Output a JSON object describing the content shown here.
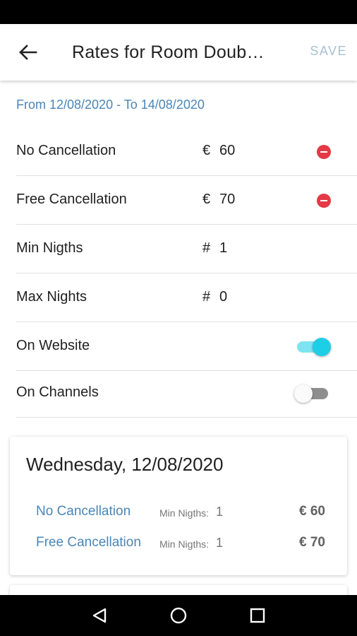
{
  "app_bar": {
    "title": "Rates for Room Doub…",
    "save_label": "SAVE"
  },
  "date_range": "From 12/08/2020 - To 14/08/2020",
  "rates": [
    {
      "label": "No Cancellation",
      "symbol": "€",
      "value": "60",
      "removable": true
    },
    {
      "label": "Free Cancellation",
      "symbol": "€",
      "value": "70",
      "removable": true
    }
  ],
  "nights": [
    {
      "label": "Min Nigths",
      "symbol": "#",
      "value": "1"
    },
    {
      "label": "Max Nights",
      "symbol": "#",
      "value": "0"
    }
  ],
  "toggles": [
    {
      "label": "On Website",
      "on": true
    },
    {
      "label": "On Channels",
      "on": false
    }
  ],
  "day_card": {
    "title": "Wednesday, 12/08/2020",
    "lines": [
      {
        "name": "No Cancellation",
        "min_label": "Min Nigths:",
        "min_value": "1",
        "price": "€ 60"
      },
      {
        "name": "Free Cancellation",
        "min_label": "Min Nigths:",
        "min_value": "1",
        "price": "€ 70"
      }
    ]
  },
  "colors": {
    "accent_blue": "#4a86b8",
    "remove_red": "#e53945",
    "toggle_on": "#1ecde6",
    "save_disabled": "#a9c1d3"
  },
  "icons": {
    "back": "arrow-left",
    "remove": "minus-circle",
    "nav_back": "triangle-left",
    "nav_home": "circle",
    "nav_recents": "square"
  }
}
